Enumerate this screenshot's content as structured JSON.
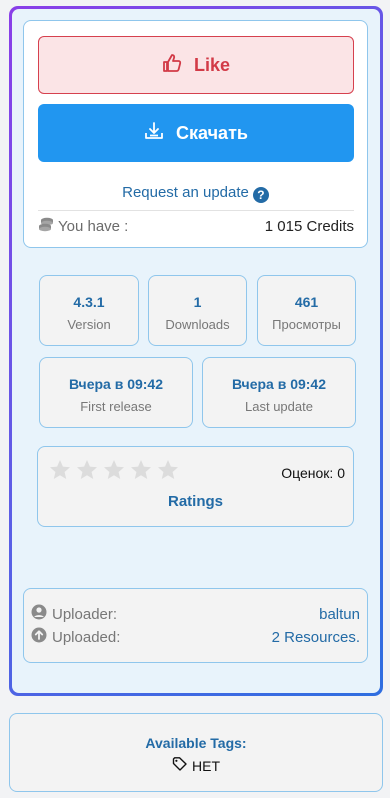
{
  "actions": {
    "like_label": "Like",
    "download_label": "Скачать",
    "request_update": "Request an update",
    "request_help": "?"
  },
  "credits": {
    "label": "You have :",
    "value": "1 015 Credits"
  },
  "stats": [
    {
      "value": "4.3.1",
      "label": "Version"
    },
    {
      "value": "1",
      "label": "Downloads"
    },
    {
      "value": "461",
      "label": "Просмотры"
    }
  ],
  "dates": [
    {
      "value": "Вчера в 09:42",
      "label": "First release"
    },
    {
      "value": "Вчера в 09:42",
      "label": "Last update"
    }
  ],
  "rating": {
    "stars_filled": 0,
    "stars_total": 5,
    "count_text": "Оценок: 0",
    "label": "Ratings"
  },
  "uploader": {
    "uploader_label": "Uploader:",
    "uploader_value": "baltun",
    "uploaded_label": "Uploaded:",
    "uploaded_value": "2 Resources."
  },
  "tags": {
    "title": "Available Tags:",
    "items": [
      "НЕТ"
    ]
  },
  "colors": {
    "accent": "#236ba6",
    "download_bg": "#2196f0",
    "like_bg": "#fbe4e6",
    "like_border": "#d6404e",
    "border": "#8fc6ec"
  }
}
